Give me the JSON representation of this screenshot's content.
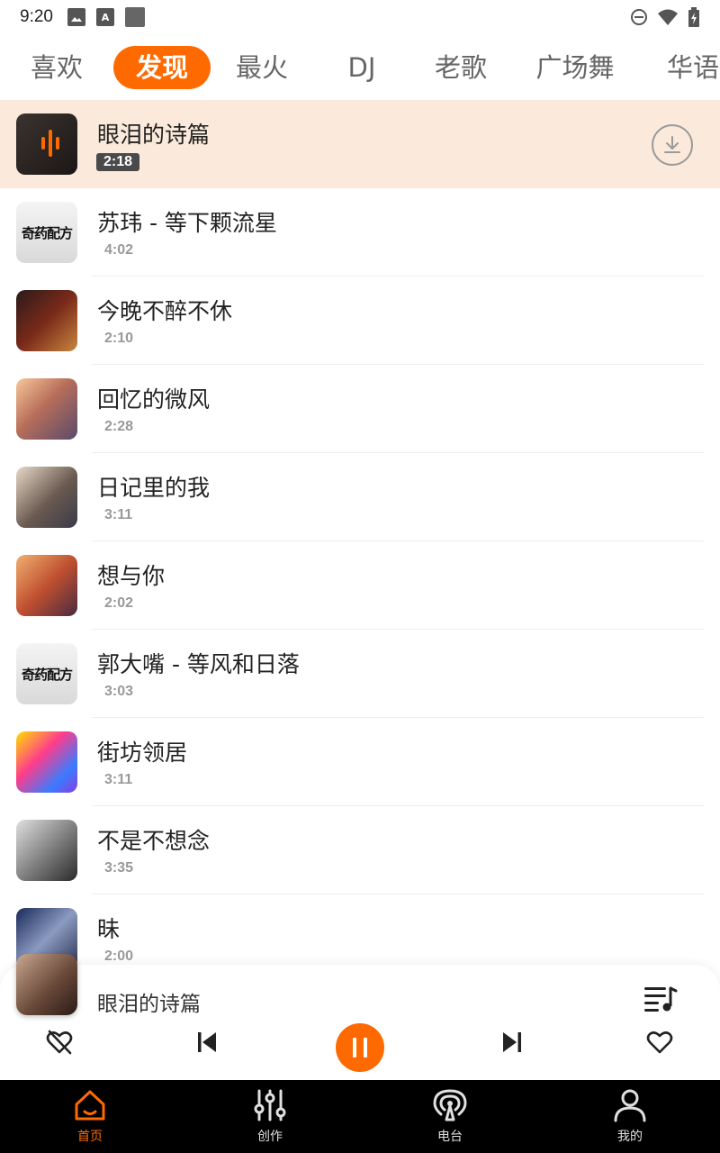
{
  "status_bar": {
    "time": "9:20",
    "left_icons": [
      "image-icon",
      "a-icon",
      "square-icon"
    ],
    "right_icons": [
      "dnd-icon",
      "wifi-icon",
      "battery-icon"
    ]
  },
  "tabs": [
    {
      "label": "喜欢"
    },
    {
      "label": "发现"
    },
    {
      "label": "最火"
    },
    {
      "label": "DJ"
    },
    {
      "label": "老歌"
    },
    {
      "label": "广场舞"
    },
    {
      "label": "华语"
    }
  ],
  "active_tab": "发现",
  "songs": [
    {
      "title": "眼泪的诗篇",
      "duration": "2:18"
    },
    {
      "title": "苏玮 - 等下颗流星",
      "duration": "4:02"
    },
    {
      "title": "今晚不醉不休",
      "duration": "2:10"
    },
    {
      "title": "回忆的微风",
      "duration": "2:28"
    },
    {
      "title": "日记里的我",
      "duration": "3:11"
    },
    {
      "title": "想与你",
      "duration": "2:02"
    },
    {
      "title": "郭大嘴 - 等风和日落",
      "duration": "3:03"
    },
    {
      "title": "街坊领居",
      "duration": "3:11"
    },
    {
      "title": "不是不想念",
      "duration": "3:35"
    },
    {
      "title": "昧",
      "duration": "2:00"
    }
  ],
  "brand_cover_text": "奇药配方",
  "player": {
    "title": "眼泪的诗篇"
  },
  "nav": [
    {
      "label": "首页"
    },
    {
      "label": "创作"
    },
    {
      "label": "电台"
    },
    {
      "label": "我的"
    }
  ],
  "colors": {
    "accent": "#ff6a00",
    "playing_row_bg": "#fbeadb",
    "nav_bg": "#000000"
  }
}
